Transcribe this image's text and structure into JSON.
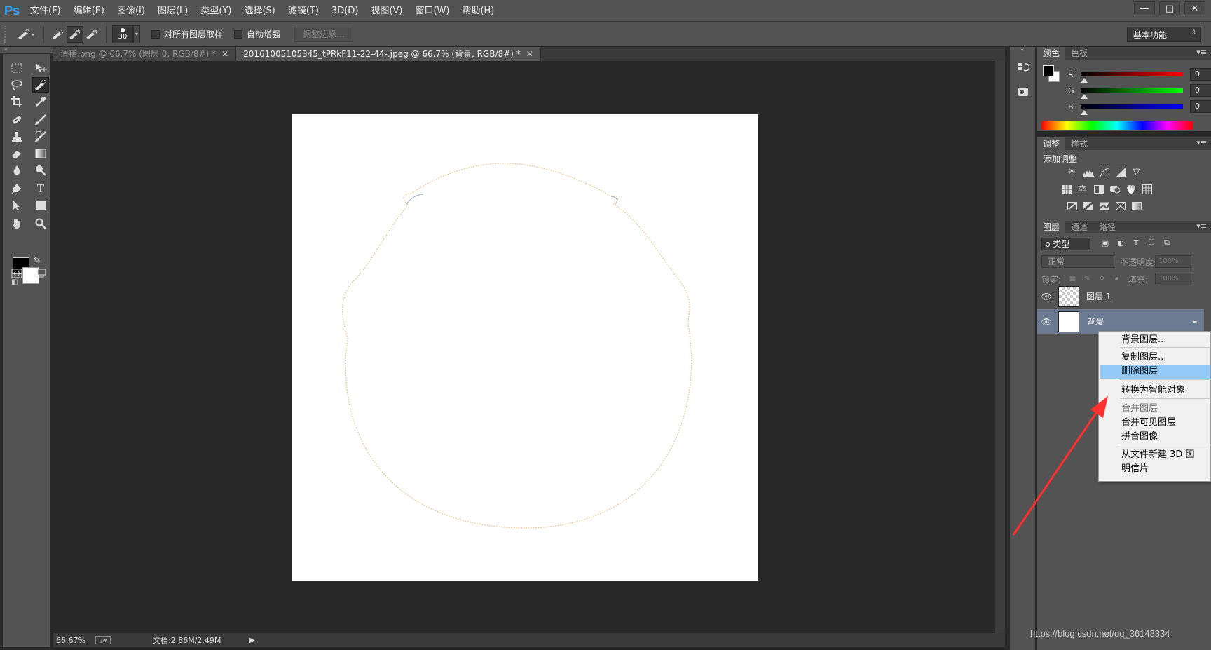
{
  "app": {
    "logo": "Ps",
    "menu": [
      "文件(F)",
      "编辑(E)",
      "图像(I)",
      "图层(L)",
      "类型(Y)",
      "选择(S)",
      "滤镜(T)",
      "3D(D)",
      "视图(V)",
      "窗口(W)",
      "帮助(H)"
    ],
    "window_controls": [
      "—",
      "□",
      "✕"
    ]
  },
  "options_bar": {
    "brush_size": "30",
    "sample_all_layers_label": "对所有图层取样",
    "auto_enhance_label": "自动增强",
    "refine_edge_label": "调整边缘...",
    "workspace": "基本功能"
  },
  "tabs": [
    {
      "title": "滑稽.png @ 66.7% (图层 0, RGB/8#) *",
      "close": "✕"
    },
    {
      "title": "20161005105345_tPRkF11-22-44-.jpeg @ 66.7% (背景, RGB/8#) *",
      "close": "✕"
    }
  ],
  "status": {
    "zoom": "66.67%",
    "doc": "文档:2.86M/2.49M"
  },
  "color_panel": {
    "tabs": [
      "颜色",
      "色板"
    ],
    "channels": [
      {
        "label": "R",
        "value": "0",
        "gradient": "#ff0000"
      },
      {
        "label": "G",
        "value": "0",
        "gradient": "#00ff00"
      },
      {
        "label": "B",
        "value": "0",
        "gradient": "#0000ff"
      }
    ]
  },
  "adjust_panel": {
    "tabs": [
      "调整",
      "样式"
    ],
    "title": "添加调整"
  },
  "layers_panel": {
    "tabs": [
      "图层",
      "通道",
      "路径"
    ],
    "filter": "ρ 类型",
    "blend_mode": "正常",
    "opacity_label": "不透明度:",
    "opacity_value": "100%",
    "lock_label": "锁定:",
    "fill_label": "填充:",
    "fill_value": "100%",
    "layers": [
      {
        "name": "图层 1"
      },
      {
        "name": "背景"
      }
    ]
  },
  "context_menu": {
    "items": [
      {
        "label": "背景图层...",
        "state": "normal"
      },
      {
        "label": "复制图层...",
        "state": "normal"
      },
      {
        "label": "删除图层",
        "state": "hover"
      },
      {
        "label": "转换为智能对象",
        "state": "normal"
      },
      {
        "label": "合并图层",
        "state": "disabled"
      },
      {
        "label": "合并可见图层",
        "state": "normal"
      },
      {
        "label": "拼合图像",
        "state": "normal"
      },
      {
        "label": "从文件新建 3D 图",
        "state": "normal"
      },
      {
        "label": "明信片",
        "state": "normal"
      }
    ]
  },
  "watermark": "https://blog.csdn.net/qq_36148334",
  "colors": {
    "accent": "#31a8ff",
    "annotation_arrow": "#ff3030",
    "menu_hover": "#91c9f7"
  }
}
